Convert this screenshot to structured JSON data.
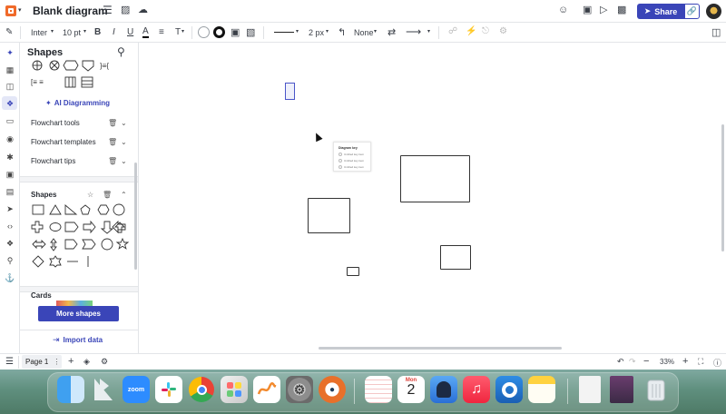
{
  "app": {
    "title": "Blank diagram",
    "share_label": "Share"
  },
  "toolbar": {
    "font": "Inter",
    "font_size": "10 pt",
    "bold": "B",
    "italic": "I",
    "underline": "U",
    "text_color": "A",
    "text_style": "T",
    "stroke_width": "2 px",
    "arrow_none": "None"
  },
  "panel": {
    "title": "Shapes",
    "ai_label": "AI Diagramming",
    "sections": [
      {
        "label": "Flowchart tools"
      },
      {
        "label": "Flowchart templates"
      },
      {
        "label": "Flowchart tips"
      }
    ],
    "shapes_header": "Shapes",
    "cards_header": "Cards",
    "more_shapes": "More shapes",
    "import_data": "Import data"
  },
  "canvas": {
    "legend_title": "Diagram key",
    "legend_items": [
      "Untitled key item",
      "Untitled key item",
      "Untitled key item"
    ]
  },
  "bottombar": {
    "page_label": "Page 1",
    "zoom": "33%"
  },
  "dock": {
    "zoom_label": "zoom",
    "calendar_month": "Mon",
    "calendar_day": "2"
  },
  "colors": {
    "accent": "#3a45b8",
    "dock_bg": "#5f8f7e"
  }
}
